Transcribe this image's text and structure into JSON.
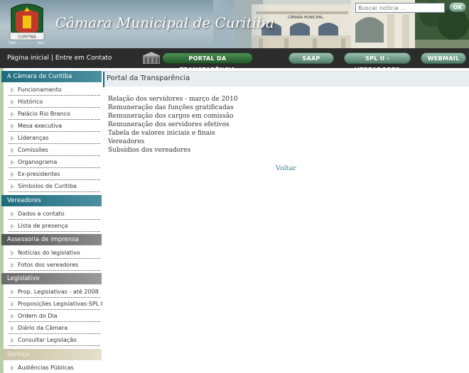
{
  "header": {
    "title": "Câmara Municipal de Curitiba",
    "building_sign": "CÂMARA MUNICIPAL",
    "coat_text": "CURITIBA",
    "coat_years": [
      "1693",
      "1853"
    ],
    "search": {
      "placeholder": "Buscar notícia ..."
    },
    "ok_label": "OK"
  },
  "nav": {
    "home": "Página inicial",
    "separator": "|",
    "contact": "Entre em Contato",
    "portal": "PORTAL DA TRANSPARÊNCIA",
    "saap": "SAAP",
    "spl": "SPL II - VEREADORES",
    "webmail": "WEBMAIL"
  },
  "sidebar": {
    "sections": [
      {
        "title": "A Câmara de Curitiba",
        "items": [
          "Funcionamento",
          "Histórico",
          "Palácio Rio Branco",
          "Mesa executiva",
          "Lideranças",
          "Comissões",
          "Organograma",
          "Ex-presidentes",
          "Símbolos de Curitiba"
        ]
      },
      {
        "title": "Vereadores",
        "items": [
          "Dados e contato",
          "Lista de presença"
        ]
      },
      {
        "title": "Assessoria de imprensa",
        "items": [
          "Notícias do legislativo",
          "Fotos dos vereadores"
        ]
      },
      {
        "title": "Legislativo",
        "items": [
          "Prop. Legislativas - até 2008",
          "Proposições Legislativas-SPL II",
          "Ordem do Dia",
          "Diário da Câmara",
          "Consultar Legislação"
        ]
      },
      {
        "title": "Serviço",
        "items": [
          "Audiências Públicas"
        ]
      }
    ]
  },
  "main": {
    "title": "Portal da Transparência",
    "links": [
      "Relação dos servidores - março de 2010",
      "Remuneração das funções gratificadas",
      "Remuneração dos cargos em comissão",
      "Remuneração dos servidores efetivos",
      "Tabela de valores iniciais e finais",
      "Vereadores",
      "Subsídios dos vereadores"
    ],
    "back": "Voltar"
  },
  "colors": {
    "teal": "#1f6c7f",
    "nav_bg": "#2c2c2c",
    "portal_green": "#2d6b35",
    "link_teal": "#3f7f93"
  }
}
